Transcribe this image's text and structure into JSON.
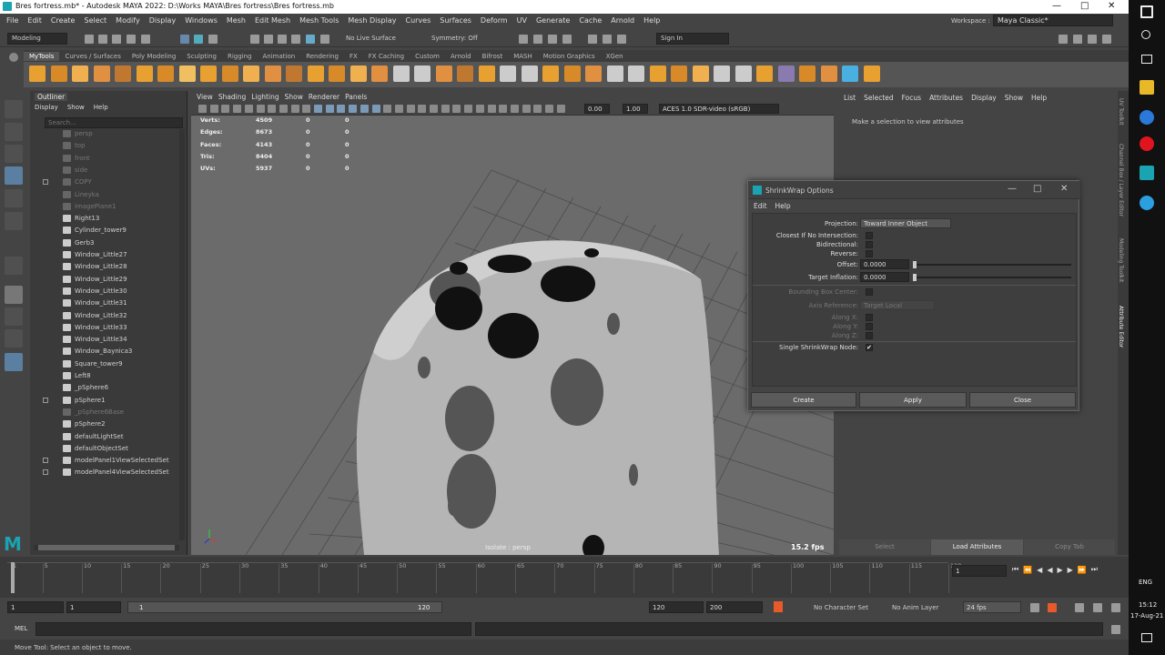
{
  "window": {
    "title": "Bres fortress.mb* - Autodesk MAYA 2022: D:\\Works MAYA\\Bres fortress\\Bres fortress.mb",
    "workspace_label": "Workspace :",
    "workspace_value": "Maya Classic*"
  },
  "menu": [
    "File",
    "Edit",
    "Create",
    "Select",
    "Modify",
    "Display",
    "Windows",
    "Mesh",
    "Edit Mesh",
    "Mesh Tools",
    "Mesh Display",
    "Curves",
    "Surfaces",
    "Deform",
    "UV",
    "Generate",
    "Cache",
    "Arnold",
    "Help"
  ],
  "toolbar": {
    "mode": "Modeling",
    "live_surface": "No Live Surface",
    "symmetry": "Symmetry: Off",
    "sign_in": "Sign In"
  },
  "shelf_tabs": [
    "MyTools",
    "Curves / Surfaces",
    "Poly Modeling",
    "Sculpting",
    "Rigging",
    "Animation",
    "Rendering",
    "FX",
    "FX Caching",
    "Custom",
    "Arnold",
    "Bifrost",
    "MASH",
    "Motion Graphics",
    "XGen"
  ],
  "outliner": {
    "title": "Outliner",
    "menu": [
      "Display",
      "Show",
      "Help"
    ],
    "search_placeholder": "Search...",
    "items": [
      {
        "label": "persp",
        "dim": true
      },
      {
        "label": "top",
        "dim": true
      },
      {
        "label": "front",
        "dim": true
      },
      {
        "label": "side",
        "dim": true
      },
      {
        "label": "COPY",
        "dim": true
      },
      {
        "label": "Lineyka",
        "dim": true
      },
      {
        "label": "imagePlane1",
        "dim": true
      },
      {
        "label": "Right13",
        "dim": false
      },
      {
        "label": "Cylinder_tower9",
        "dim": false
      },
      {
        "label": "Gerb3",
        "dim": false
      },
      {
        "label": "Window_Little27",
        "dim": false
      },
      {
        "label": "Window_Little28",
        "dim": false
      },
      {
        "label": "Window_Little29",
        "dim": false
      },
      {
        "label": "Window_Little30",
        "dim": false
      },
      {
        "label": "Window_Little31",
        "dim": false
      },
      {
        "label": "Window_Little32",
        "dim": false
      },
      {
        "label": "Window_Little33",
        "dim": false
      },
      {
        "label": "Window_Little34",
        "dim": false
      },
      {
        "label": "Window_Baynica3",
        "dim": false
      },
      {
        "label": "Square_tower9",
        "dim": false
      },
      {
        "label": "Left8",
        "dim": false
      },
      {
        "label": "_pSphere6",
        "dim": false
      },
      {
        "label": "pSphere1",
        "dim": false
      },
      {
        "label": "_pSphere6Base",
        "dim": true
      },
      {
        "label": "pSphere2",
        "dim": false
      },
      {
        "label": "defaultLightSet",
        "dim": false
      },
      {
        "label": "defaultObjectSet",
        "dim": false
      },
      {
        "label": "modelPanel1ViewSelectedSet",
        "dim": false
      },
      {
        "label": "modelPanel4ViewSelectedSet",
        "dim": false
      }
    ]
  },
  "viewport": {
    "menu": [
      "View",
      "Shading",
      "Lighting",
      "Show",
      "Renderer",
      "Panels"
    ],
    "field1": "0.00",
    "field2": "1.00",
    "color_space": "ACES 1.0 SDR-video (sRGB)",
    "hud": [
      {
        "label": "Verts:",
        "v1": "4509",
        "v2": "0",
        "v3": "0"
      },
      {
        "label": "Edges:",
        "v1": "8673",
        "v2": "0",
        "v3": "0"
      },
      {
        "label": "Faces:",
        "v1": "4143",
        "v2": "0",
        "v3": "0"
      },
      {
        "label": "Tris:",
        "v1": "8404",
        "v2": "0",
        "v3": "0"
      },
      {
        "label": "UVs:",
        "v1": "5937",
        "v2": "0",
        "v3": "0"
      }
    ],
    "isolate": "Isolate : persp",
    "fps": "15.2 fps"
  },
  "attribute_editor": {
    "menu": [
      "List",
      "Selected",
      "Focus",
      "Attributes",
      "Display",
      "Show",
      "Help"
    ],
    "message": "Make a selection to view attributes",
    "buttons": {
      "select": "Select",
      "load": "Load Attributes",
      "copy": "Copy Tab"
    },
    "side_tabs": [
      "UV Toolkit",
      "Channel Box / Layer Editor",
      "Modeling Toolkit",
      "Attribute Editor"
    ]
  },
  "dialog": {
    "title": "ShrinkWrap Options",
    "menu": [
      "Edit",
      "Help"
    ],
    "projection_label": "Projection:",
    "projection_value": "Toward Inner Object",
    "closest_label": "Closest If No Intersection:",
    "bidirectional_label": "Bidirectional:",
    "reverse_label": "Reverse:",
    "offset_label": "Offset:",
    "offset_value": "0.0000",
    "inflation_label": "Target Inflation:",
    "inflation_value": "0.0000",
    "bbox_label": "Bounding Box Center:",
    "axis_label": "Axis Reference:",
    "axis_value": "Target Local",
    "alongx": "Along X:",
    "alongy": "Along Y:",
    "alongz": "Along Z:",
    "single_label": "Single ShrinkWrap Node:",
    "single_checked": "✔",
    "create": "Create",
    "apply": "Apply",
    "close": "Close"
  },
  "timeline": {
    "ticks": [
      "1",
      "5",
      "10",
      "15",
      "20",
      "25",
      "30",
      "35",
      "40",
      "45",
      "50",
      "55",
      "60",
      "65",
      "70",
      "75",
      "80",
      "85",
      "90",
      "95",
      "100",
      "105",
      "110",
      "115",
      "120"
    ],
    "current": "1"
  },
  "range": {
    "start": "1",
    "start2": "1",
    "slider_start": "1",
    "slider_end": "120",
    "end": "120",
    "end2": "200",
    "character_set": "No Character Set",
    "anim_layer": "No Anim Layer",
    "fps": "24 fps"
  },
  "mel": {
    "label": "MEL"
  },
  "status": "Move Tool: Select an object to move.",
  "taskbar": {
    "lang": "ENG",
    "time": "15:12",
    "date": "17-Aug-21"
  }
}
